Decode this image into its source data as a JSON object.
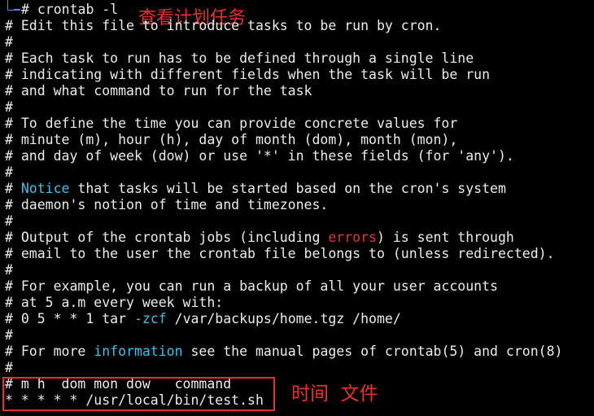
{
  "prompt": {
    "command": "# crontab -l"
  },
  "annotations": {
    "title": "查看计划任务",
    "bottom": "时间  文件",
    "color": "#e8312c"
  },
  "colors": {
    "background": "#000000",
    "text": "#ececec",
    "highlight_blue": "#3cc2ee",
    "highlight_red": "#e03a3a"
  },
  "lines": {
    "l01": "# Edit this file to introduce tasks to be run by cron.",
    "l02": "#",
    "l03": "# Each task to run has to be defined through a single line",
    "l04": "# indicating with different fields when the task will be run",
    "l05": "# and what command to run for the task",
    "l06": "#",
    "l07": "# To define the time you can provide concrete values for",
    "l08": "# minute (m), hour (h), day of month (dom), month (mon),",
    "l09": "# and day of week (dow) or use '*' in these fields (for 'any').",
    "l10": "#",
    "l11": {
      "pre": "# ",
      "hl": "Notice",
      "post": " that tasks will be started based on the cron's system"
    },
    "l12": "# daemon's notion of time and timezones.",
    "l13": "#",
    "l14": {
      "pre": "# Output of the crontab jobs (including ",
      "hl": "errors",
      "post": ") is sent through"
    },
    "l15": "# email to the user the crontab file belongs to (unless redirected).",
    "l16": "#",
    "l17": "# For example, you can run a backup of all your user accounts",
    "l18": "# at 5 a.m every week with:",
    "l19": {
      "pre": "# 0 5 * * 1 tar ",
      "hl": "-zcf",
      "post": " /var/backups/home.tgz /home/"
    },
    "l20": "#",
    "l21": {
      "pre": "# For more ",
      "hl": "information",
      "post": " see the manual pages of crontab(5) and cron(8)"
    },
    "l22": "#",
    "l23": "# m h  dom mon dow   command",
    "l24": "* * * * * /usr/local/bin/test.sh"
  }
}
